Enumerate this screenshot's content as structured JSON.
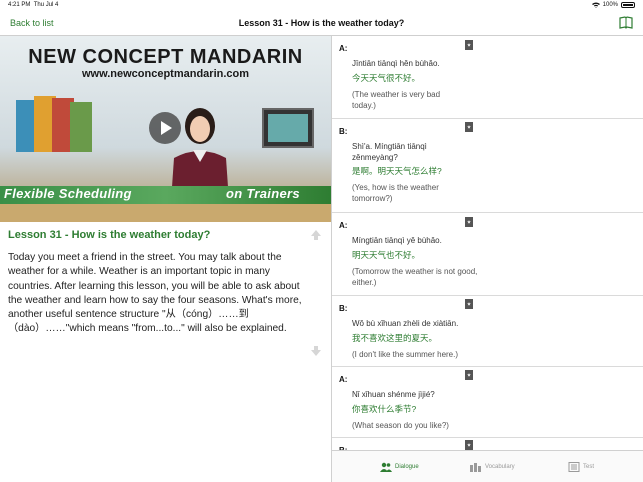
{
  "status_bar": {
    "time": "4:21 PM",
    "date": "Thu Jul 4",
    "battery": "100%"
  },
  "nav": {
    "back_label": "Back to list",
    "title": "Lesson 31 - How is the weather today?",
    "book_icon": "book-icon"
  },
  "video": {
    "banner_title": "NEW CONCEPT MANDARIN",
    "banner_url": "www.newconceptmandarin.com",
    "strip_text": "Flexible Scheduling",
    "strip_text_right": "on Trainers"
  },
  "lesson": {
    "heading": "Lesson 31 - How is the weather today?",
    "description": "Today you meet a friend in the street. You may talk about the weather for a while. Weather is an important topic in many countries. After learning this lesson, you will be able to ask about the weather and learn how to say the four seasons. What's more, another useful sentence structure \"从（cóng）……到（dào）……\"which means \"from...to...\" will also be explained."
  },
  "dialogue": [
    {
      "speaker": "A:",
      "pinyin": "Jīntiān tiānqì hěn bùhǎo.",
      "hanzi": "今天天气很不好。",
      "translation": "(The weather is very bad today.)"
    },
    {
      "speaker": "B:",
      "pinyin": "Shì'a. Míngtiān tiānqì zěnmeyàng?",
      "hanzi": "是啊。明天天气怎么样?",
      "translation": "(Yes, how is the weather tomorrow?)"
    },
    {
      "speaker": "A:",
      "pinyin": "Míngtiān tiānqì yě bùhǎo.",
      "hanzi": "明天天气也不好。",
      "translation": "(Tomorrow the weather is not good, either.)"
    },
    {
      "speaker": "B:",
      "pinyin": "Wǒ bù xǐhuan zhèli de xiàtiān.",
      "hanzi": "我不喜欢这里的夏天。",
      "translation": "(I don't like the summer here.)"
    },
    {
      "speaker": "A:",
      "pinyin": "Nǐ xǐhuan shénme jìjié?",
      "hanzi": "你喜欢什么季节?",
      "translation": "(What season do you like?)"
    },
    {
      "speaker": "B:",
      "pinyin": "",
      "hanzi": "",
      "translation": ""
    }
  ],
  "tabs": [
    {
      "label": "Dialogue",
      "icon": "people-icon",
      "active": true
    },
    {
      "label": "Vocabulary",
      "icon": "blocks-icon",
      "active": false
    },
    {
      "label": "Test",
      "icon": "checklist-icon",
      "active": false
    }
  ],
  "colors": {
    "accent": "#2e7d32",
    "inactive": "#9a9a9a"
  }
}
